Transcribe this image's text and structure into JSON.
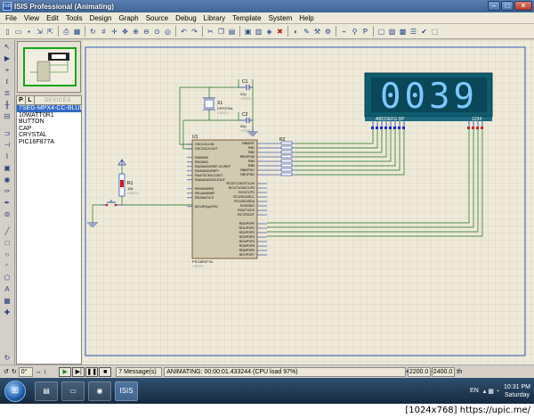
{
  "window": {
    "title": "ISIS Professional (Animating)",
    "app_icon": "ISIS"
  },
  "menu": [
    "File",
    "View",
    "Edit",
    "Tools",
    "Design",
    "Graph",
    "Source",
    "Debug",
    "Library",
    "Template",
    "System",
    "Help"
  ],
  "devices_panel": {
    "tab_p": "P",
    "tab_l": "L",
    "title": "DEVICES",
    "items": [
      "7SEG-MPX4-CC-BLUE",
      "10WATT0R1",
      "BUTTON",
      "CAP",
      "CRYSTAL",
      "PIC16F877A"
    ]
  },
  "schematic": {
    "display_value": "0039",
    "display_pins_left": "ABCDEFG DP",
    "display_pins_right": "1234",
    "u1": {
      "ref": "U1",
      "part": "PIC16F877A",
      "left_pins": [
        "OSC1/CLKIN",
        "OSC2/CLKOUT",
        "",
        "RA0/AN0",
        "RA1/AN1",
        "RA2/AN2/VREF-/CVREF",
        "RA3/AN3/VREF+",
        "RA4/T0CKI/C1OUT",
        "RA5/AN4/SS/C2OUT",
        "",
        "RE0/AN5/RD",
        "RE1/AN6/WR",
        "RE2/AN7/CS",
        "",
        "MCLR/Vpp/THV"
      ],
      "right_pins": [
        "RB0/INT",
        "RB1",
        "RB2",
        "RB3/PGM",
        "RB4",
        "RB5",
        "RB6/PGC",
        "RB7/PGD",
        "",
        "RC0/T1OSO/T1CKI",
        "RC1/T1OSI/CCP2",
        "RC2/CCP1",
        "RC3/SCK/SCL",
        "RC4/SDI/SDA",
        "RC5/SDO",
        "RC6/TX/CK",
        "RC7/RX/DT",
        "",
        "RD0/PSP0",
        "RD1/PSP1",
        "RD2/PSP2",
        "RD3/PSP3",
        "RD4/PSP4",
        "RD5/PSP5",
        "RD6/PSP6",
        "RD7/PSP7"
      ]
    },
    "c1": {
      "ref": "C1",
      "value": "22p"
    },
    "c2": {
      "ref": "C2",
      "value": "22p"
    },
    "x1": {
      "ref": "X1",
      "value": "CRYSTAL"
    },
    "r1": {
      "ref": "R1",
      "value": "10k"
    },
    "r2": {
      "ref": "R2"
    },
    "text_placeholder": "<TEXT>"
  },
  "status": {
    "angle": "0°",
    "messages": "7 Message(s)",
    "animating": "ANIMATING: 00:00:01.433244 (CPU load 97%)",
    "coord_x": "+2200.0",
    "coord_y": "-2400.0",
    "unit": "th"
  },
  "taskbar": {
    "lang": "EN",
    "time": "10:31 PM",
    "day": "Saturday",
    "isis_task": "ISIS"
  },
  "watermark": "[1024x768] https://upic.me/"
}
